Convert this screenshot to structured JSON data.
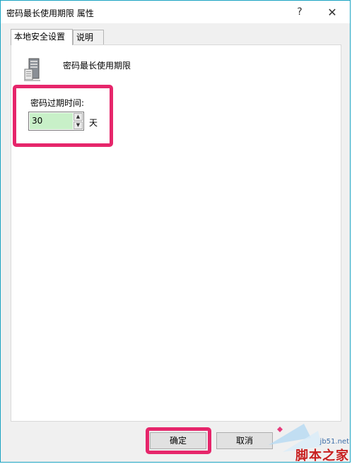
{
  "window": {
    "title": "密码最长使用期限 属性",
    "help_glyph": "?",
    "close_glyph": "✕",
    "border_color": "#1aa3c2"
  },
  "tabs": [
    {
      "label": "本地安全设置",
      "active": true
    },
    {
      "label": "说明",
      "active": false
    }
  ],
  "policy": {
    "icon": "server-icon",
    "name": "密码最长使用期限"
  },
  "expiration": {
    "label": "密码过期时间:",
    "value": "30",
    "unit": "天",
    "input_bg": "#c8f0c8"
  },
  "buttons": {
    "ok_label": "确定",
    "cancel_label": "取消"
  },
  "highlight_color": "#e6266b",
  "watermark": {
    "site": "jb51.net",
    "name": "脚本之家"
  }
}
